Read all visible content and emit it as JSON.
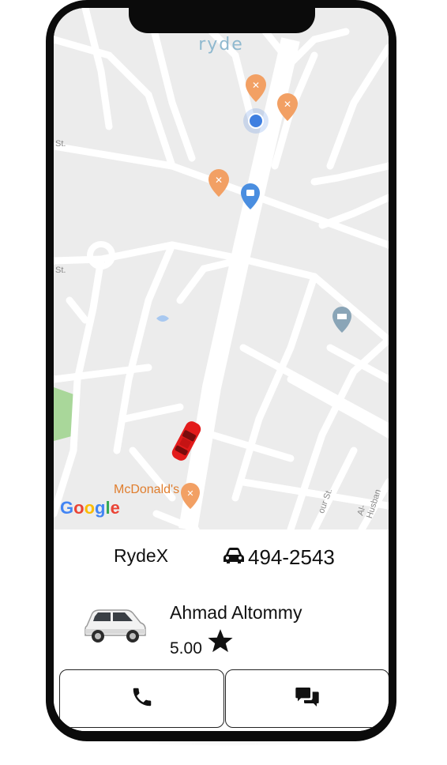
{
  "map": {
    "brand": "ryde",
    "google_logo": [
      "G",
      "o",
      "o",
      "g",
      "l",
      "e"
    ],
    "google_colors": [
      "#4285F4",
      "#EA4335",
      "#FBBC05",
      "#4285F4",
      "#34A853",
      "#EA4335"
    ],
    "poi_label": "McDonald's",
    "street_labels": [
      "St.",
      "St.",
      "our St.",
      "Al-Husban"
    ]
  },
  "ride": {
    "service_name": "RydeX",
    "plate_number": "494-2543"
  },
  "driver": {
    "name": "Ahmad Altommy",
    "rating": "5.00",
    "rating_icon": "star-icon"
  },
  "actions": {
    "call_icon": "phone-icon",
    "message_icon": "chat-icon"
  },
  "colors": {
    "poi_marker": "#f2a064",
    "shop_marker": "#4a8ee0",
    "museum_marker": "#8aa5b7",
    "car": "#e31b1b",
    "park": "#a9d79a",
    "location_dot": "#3f7fe0"
  }
}
